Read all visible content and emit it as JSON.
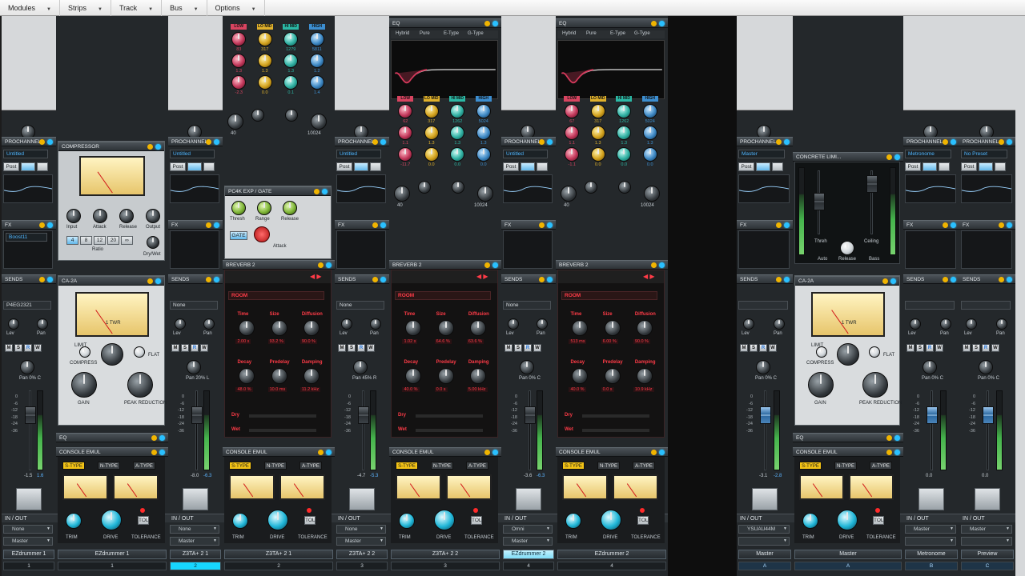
{
  "menu": [
    {
      "label": "Modules"
    },
    {
      "label": "Strips"
    },
    {
      "label": "Track"
    },
    {
      "label": "Bus"
    },
    {
      "label": "Options"
    }
  ],
  "common": {
    "prochannel": "PROCHANNEL",
    "fx": "FX",
    "sends": "SENDS",
    "post": "Post",
    "in_out": "IN / OUT",
    "pan": "Pan",
    "lev": "Lev"
  },
  "tracks": [
    {
      "name": "EZdrummer 1",
      "number": "1",
      "gain": "Gain -32",
      "preset": "Untitled",
      "send": "P4EG2321",
      "pan": "Pan 0% C",
      "fader_readout": "-1.5",
      "peak": "1.6",
      "input": "None",
      "output": "Master",
      "fx_slot": "Boost11"
    },
    {
      "name": "Z3TA+ 2 1",
      "number": "2",
      "gain": "Gain 3",
      "preset": "Untitled",
      "send": "None",
      "pan": "Pan 20% L",
      "fader_readout": "-8.0",
      "peak": "-6.3",
      "input": "None",
      "output": "Master"
    },
    {
      "name": "Z3TA+ 2 2",
      "number": "3",
      "gain": "Gain 78",
      "preset": "Untitled",
      "send": "None",
      "pan": "Pan 45% R",
      "fader_readout": "-4.7",
      "peak": "-5.3",
      "input": "None",
      "output": "Master"
    },
    {
      "name": "EZdrummer 2",
      "number": "4",
      "gain": "Gain -51",
      "preset": "Untitled",
      "send": "None",
      "pan": "Pan 0% C",
      "fader_readout": "-3.6",
      "peak": "-6.3",
      "input": "Omni",
      "output": "Master"
    }
  ],
  "buses": [
    {
      "name": "Master",
      "number": "A",
      "gain": "Gain -4.6",
      "pan_readout": "Pan C",
      "preset": "Master",
      "pan": "Pan 0% C",
      "fader_readout": "-3.1",
      "peak": "-2.8",
      "input": "YSUAU44M",
      "output": ""
    },
    {
      "name": "Metronome",
      "number": "B",
      "gain": "Gain 0.0",
      "pan_readout": "Pan C",
      "preset": "Metronome",
      "pan": "Pan 0% C",
      "fader_readout": "0.0",
      "peak": "",
      "input": "Master",
      "output": ""
    },
    {
      "name": "Preview",
      "number": "C",
      "gain": "Gain 0.0",
      "pan_readout": "Pan C",
      "preset": "No Preset",
      "pan": "Pan 0% C",
      "fader_readout": "0.0",
      "peak": "",
      "input": "Master",
      "output": ""
    }
  ],
  "plugins": {
    "compressor": {
      "title": "COMPRESSOR",
      "knobs": [
        "Input",
        "Attack",
        "Release",
        "Output"
      ],
      "ratio_label": "Ratio",
      "ratios": [
        "4",
        "8",
        "12",
        "20",
        "∞"
      ],
      "drywet": "Dry/Wet"
    },
    "ca2a": {
      "title": "CA-2A",
      "needle_label": "1 TWR",
      "labels": [
        "LIMIT",
        "GR",
        "+4",
        "HF",
        "FLAT"
      ],
      "low": "GAIN",
      "low2": "PEAK REDUCTION",
      "compress": "COMPRESS"
    },
    "eq": {
      "title": "EQ",
      "modes": [
        "Hybrid",
        "Pure",
        "E-Type",
        "G-Type"
      ],
      "bands": [
        "LOW",
        "LO MID",
        "HI MID",
        "HIGH"
      ]
    },
    "eq_strip2": {
      "freq": [
        "83",
        "317",
        "1279",
        "5811"
      ],
      "gain": [
        "1.3",
        "1.3",
        "1.3",
        "1.2"
      ],
      "q": [
        "-2.3",
        "0.0",
        "0.1",
        "1.4"
      ],
      "hp": "40",
      "lp": "10024"
    },
    "eq_strip3": {
      "freq": [
        "62",
        "317",
        "1262",
        "5024"
      ],
      "gain": [
        "1.1",
        "1.3",
        "1.3",
        "1.3"
      ],
      "q": [
        "-11.7",
        "0.0",
        "0.0",
        "0.0"
      ],
      "hp": "40",
      "lp": "10024"
    },
    "eq_strip4": {
      "freq": [
        "67",
        "317",
        "1262",
        "5024"
      ],
      "gain": [
        "1.1",
        "1.3",
        "1.3",
        "1.3"
      ],
      "q": [
        "-1.1",
        "0.0",
        "0.0",
        "0.0"
      ],
      "hp": "40",
      "lp": "10024"
    },
    "gate": {
      "title": "PC4K EXP / GATE",
      "knobs": [
        "Thresh",
        "Range",
        "Release"
      ],
      "gate_btn": "GATE",
      "attack": "Attack"
    },
    "breverb": {
      "title": "BREVERB 2",
      "preset": "ROOM",
      "labels": [
        "Time",
        "Size",
        "Diffusion",
        "Decay",
        "Predelay",
        "Damping"
      ],
      "dry": "Dry",
      "wet": "Wet"
    },
    "breverb_strip2": {
      "values": [
        "2.00 s",
        "93.2 %",
        "90.0 %",
        "48.0 %",
        "10.0 ms",
        "11.2 kHz"
      ]
    },
    "breverb_strip3": {
      "values": [
        "1.02 s",
        "64.6 %",
        "63.6 %",
        "40.0 %",
        "0.0 s",
        "5.00 kHz"
      ]
    },
    "breverb_strip4": {
      "values": [
        "513 ms",
        "6.00 %",
        "90.0 %",
        "40.0 %",
        "0.0 s",
        "10.9 kHz"
      ]
    },
    "console": {
      "title": "CONSOLE EMUL",
      "types": [
        "S-TYPE",
        "N-TYPE",
        "A-TYPE"
      ],
      "knobs": [
        "TRIM",
        "DRIVE",
        "TOLERANCE"
      ],
      "tol": "TOL"
    },
    "limiter": {
      "title": "CONCRETE LIMI...",
      "labels": [
        "Threh",
        "Ceiling",
        "Auto",
        "Release",
        "Bass"
      ],
      "input": "INPUT",
      "output": "OUTPUT"
    }
  },
  "fader_scale": [
    "0",
    "-6",
    "-12",
    "-18",
    "-24",
    "-36"
  ]
}
